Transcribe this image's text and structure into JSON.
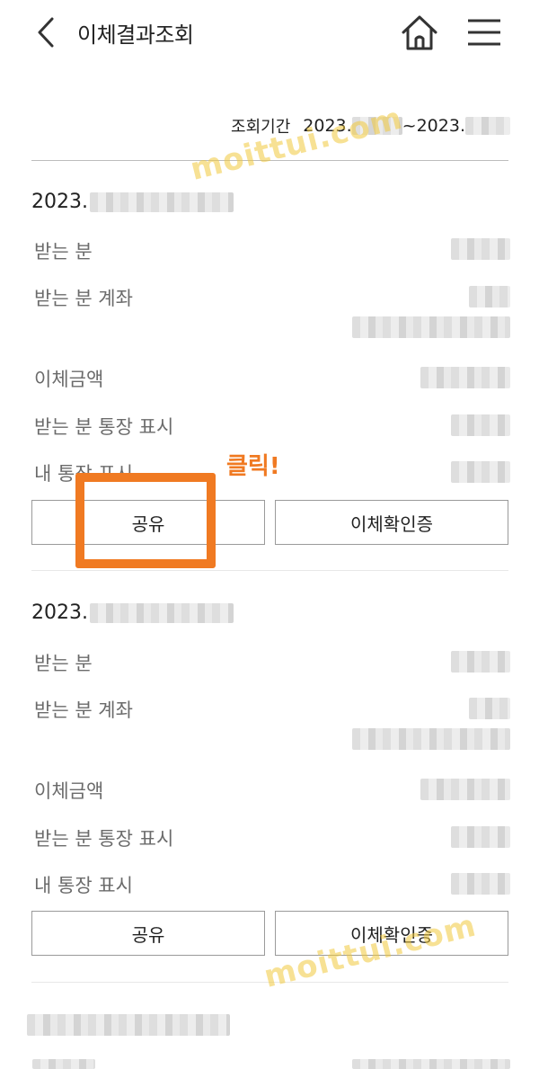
{
  "header": {
    "title": "이체결과조회",
    "back_icon": "chevron-left-icon",
    "home_icon": "home-icon",
    "menu_icon": "hamburger-menu-icon"
  },
  "period": {
    "label": "조회기간",
    "start_prefix": "2023.",
    "separator": "~",
    "end_prefix": "2023."
  },
  "records": [
    {
      "date_prefix": "2023.",
      "labels": {
        "recipient": "받는 분",
        "recipient_account": "받는 분 계좌",
        "amount": "이체금액",
        "recipient_memo": "받는 분 통장 표시",
        "my_memo": "내 통장 표시"
      },
      "share_label": "공유",
      "confirm_label": "이체확인증"
    },
    {
      "date_prefix": "2023.",
      "labels": {
        "recipient": "받는 분",
        "recipient_account": "받는 분 계좌",
        "amount": "이체금액",
        "recipient_memo": "받는 분 통장 표시",
        "my_memo": "내 통장 표시"
      },
      "share_label": "공유",
      "confirm_label": "이체확인증"
    }
  ],
  "annotation": {
    "text": "클릭!",
    "color": "#f07a22"
  },
  "watermark": "moittui.com",
  "colors": {
    "accent": "#f07a22",
    "label_gray": "#6b6b6b",
    "border": "#9a9a9a"
  }
}
